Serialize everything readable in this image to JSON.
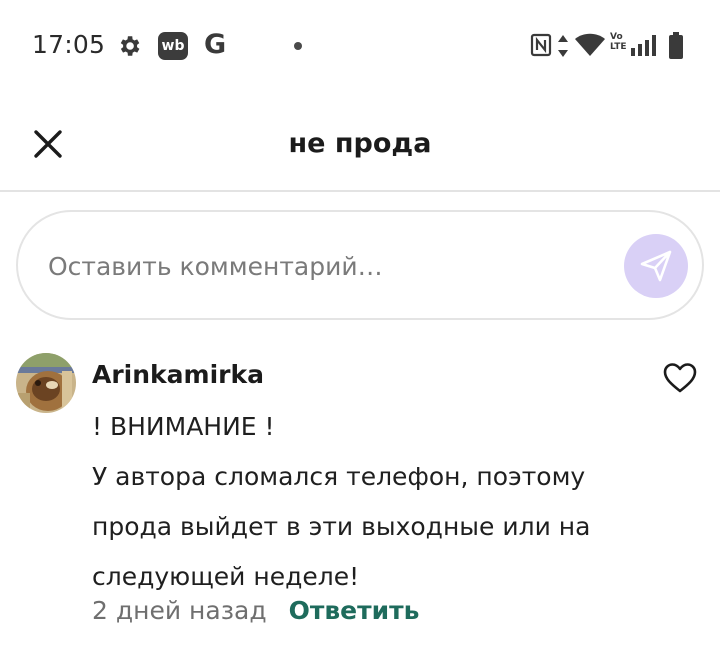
{
  "status_bar": {
    "time": "17:05",
    "icons": [
      "gear-icon",
      "wb-app-icon",
      "google-icon",
      "notification-dot-icon",
      "nfc-icon",
      "data-arrows-icon",
      "wifi-icon",
      "volte-icon",
      "signal-icon",
      "battery-icon"
    ],
    "wb_label": "wb",
    "google_label": "G",
    "volte_top": "Vo",
    "volte_bottom": "LTE"
  },
  "header": {
    "title": "не прода",
    "close_icon": "close-icon"
  },
  "comment_input": {
    "placeholder": "Оставить комментарий…",
    "value": "",
    "send_icon": "send-icon"
  },
  "comments": [
    {
      "author": "Arinkamirka",
      "body_lines": [
        "! ВНИМАНИЕ !",
        "У автора сломался телефон, поэтому",
        "прода выйдет в эти выходные или на",
        "следующей неделе!"
      ],
      "timestamp": "2 дней назад",
      "reply_label": "Ответить",
      "like_icon": "heart-icon"
    }
  ],
  "colors": {
    "accent_send_bg": "#d9d0f6",
    "reply_color": "#1e6b5c",
    "divider": "#e3e3e3"
  }
}
